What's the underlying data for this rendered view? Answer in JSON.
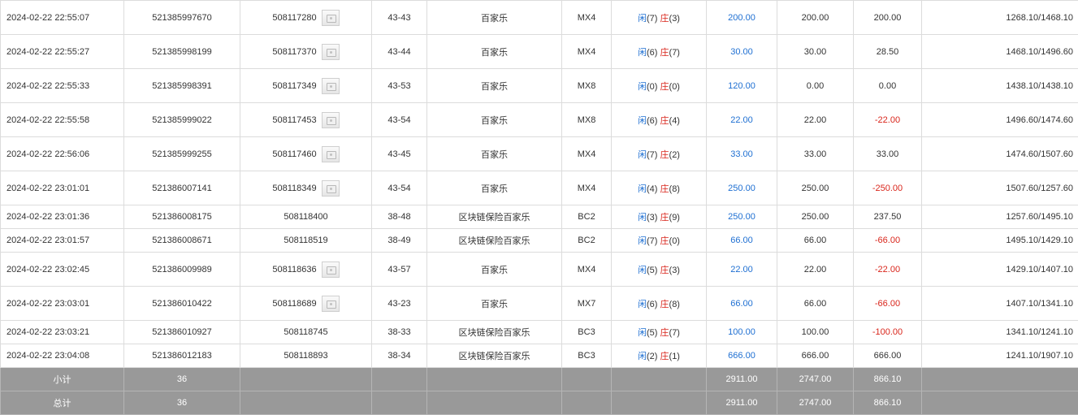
{
  "table": {
    "rows": [
      {
        "time": "2024-02-22 22:55:07",
        "order": "521385997670",
        "round": "508117280",
        "thumb": true,
        "table": "43-43",
        "game": "百家乐",
        "room": "MX4",
        "r1": "闲",
        "n1": "(7)",
        "r2": "庄",
        "n2": "(3)",
        "bet": "200.00",
        "valid": "200.00",
        "win": "200.00",
        "win_neg": false,
        "balance": "1268.10/1468.10"
      },
      {
        "time": "2024-02-22 22:55:27",
        "order": "521385998199",
        "round": "508117370",
        "thumb": true,
        "table": "43-44",
        "game": "百家乐",
        "room": "MX4",
        "r1": "闲",
        "n1": "(6)",
        "r2": "庄",
        "n2": "(7)",
        "bet": "30.00",
        "valid": "30.00",
        "win": "28.50",
        "win_neg": false,
        "balance": "1468.10/1496.60"
      },
      {
        "time": "2024-02-22 22:55:33",
        "order": "521385998391",
        "round": "508117349",
        "thumb": true,
        "table": "43-53",
        "game": "百家乐",
        "room": "MX8",
        "r1": "闲",
        "n1": "(0)",
        "r2": "庄",
        "n2": "(0)",
        "bet": "120.00",
        "valid": "0.00",
        "win": "0.00",
        "win_neg": false,
        "balance": "1438.10/1438.10"
      },
      {
        "time": "2024-02-22 22:55:58",
        "order": "521385999022",
        "round": "508117453",
        "thumb": true,
        "table": "43-54",
        "game": "百家乐",
        "room": "MX8",
        "r1": "闲",
        "n1": "(6)",
        "r2": "庄",
        "n2": "(4)",
        "bet": "22.00",
        "valid": "22.00",
        "win": "-22.00",
        "win_neg": true,
        "balance": "1496.60/1474.60"
      },
      {
        "time": "2024-02-22 22:56:06",
        "order": "521385999255",
        "round": "508117460",
        "thumb": true,
        "table": "43-45",
        "game": "百家乐",
        "room": "MX4",
        "r1": "闲",
        "n1": "(7)",
        "r2": "庄",
        "n2": "(2)",
        "bet": "33.00",
        "valid": "33.00",
        "win": "33.00",
        "win_neg": false,
        "balance": "1474.60/1507.60"
      },
      {
        "time": "2024-02-22 23:01:01",
        "order": "521386007141",
        "round": "508118349",
        "thumb": true,
        "table": "43-54",
        "game": "百家乐",
        "room": "MX4",
        "r1": "闲",
        "n1": "(4)",
        "r2": "庄",
        "n2": "(8)",
        "bet": "250.00",
        "valid": "250.00",
        "win": "-250.00",
        "win_neg": true,
        "balance": "1507.60/1257.60"
      },
      {
        "time": "2024-02-22 23:01:36",
        "order": "521386008175",
        "round": "508118400",
        "thumb": false,
        "table": "38-48",
        "game": "区块链保险百家乐",
        "room": "BC2",
        "r1": "闲",
        "n1": "(3)",
        "r2": "庄",
        "n2": "(9)",
        "bet": "250.00",
        "valid": "250.00",
        "win": "237.50",
        "win_neg": false,
        "balance": "1257.60/1495.10"
      },
      {
        "time": "2024-02-22 23:01:57",
        "order": "521386008671",
        "round": "508118519",
        "thumb": false,
        "table": "38-49",
        "game": "区块链保险百家乐",
        "room": "BC2",
        "r1": "闲",
        "n1": "(7)",
        "r2": "庄",
        "n2": "(0)",
        "bet": "66.00",
        "valid": "66.00",
        "win": "-66.00",
        "win_neg": true,
        "balance": "1495.10/1429.10"
      },
      {
        "time": "2024-02-22 23:02:45",
        "order": "521386009989",
        "round": "508118636",
        "thumb": true,
        "table": "43-57",
        "game": "百家乐",
        "room": "MX4",
        "r1": "闲",
        "n1": "(5)",
        "r2": "庄",
        "n2": "(3)",
        "bet": "22.00",
        "valid": "22.00",
        "win": "-22.00",
        "win_neg": true,
        "balance": "1429.10/1407.10"
      },
      {
        "time": "2024-02-22 23:03:01",
        "order": "521386010422",
        "round": "508118689",
        "thumb": true,
        "table": "43-23",
        "game": "百家乐",
        "room": "MX7",
        "r1": "闲",
        "n1": "(6)",
        "r2": "庄",
        "n2": "(8)",
        "bet": "66.00",
        "valid": "66.00",
        "win": "-66.00",
        "win_neg": true,
        "balance": "1407.10/1341.10"
      },
      {
        "time": "2024-02-22 23:03:21",
        "order": "521386010927",
        "round": "508118745",
        "thumb": false,
        "table": "38-33",
        "game": "区块链保险百家乐",
        "room": "BC3",
        "r1": "闲",
        "n1": "(5)",
        "r2": "庄",
        "n2": "(7)",
        "bet": "100.00",
        "valid": "100.00",
        "win": "-100.00",
        "win_neg": true,
        "balance": "1341.10/1241.10"
      },
      {
        "time": "2024-02-22 23:04:08",
        "order": "521386012183",
        "round": "508118893",
        "thumb": false,
        "table": "38-34",
        "game": "区块链保险百家乐",
        "room": "BC3",
        "r1": "闲",
        "n1": "(2)",
        "r2": "庄",
        "n2": "(1)",
        "bet": "666.00",
        "valid": "666.00",
        "win": "666.00",
        "win_neg": false,
        "balance": "1241.10/1907.10"
      }
    ],
    "summary": [
      {
        "label": "小计",
        "count": "36",
        "bet": "2911.00",
        "valid": "2747.00",
        "win": "866.10"
      },
      {
        "label": "总计",
        "count": "36",
        "bet": "2911.00",
        "valid": "2747.00",
        "win": "866.10"
      }
    ]
  },
  "colors": {
    "blue": "#1e6fd2",
    "red": "#d9261c",
    "summary_bg": "#999999"
  },
  "icons": {
    "round_thumbnail": "round-thumbnail-icon"
  }
}
